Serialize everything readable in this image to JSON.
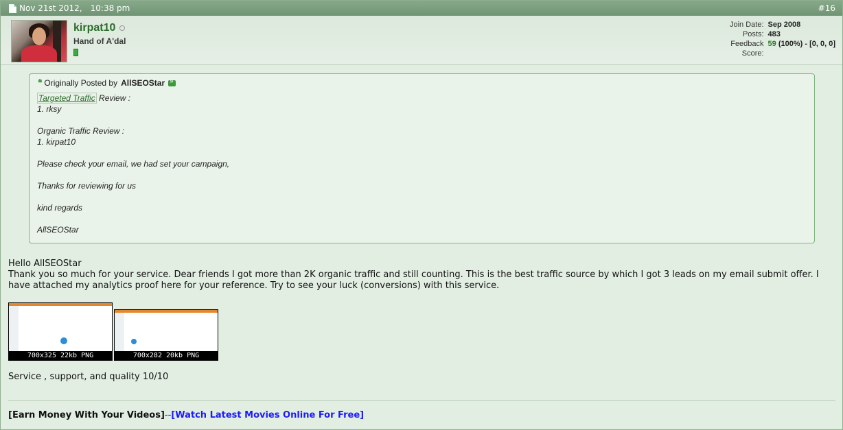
{
  "post": {
    "date": "Nov 21st 2012,",
    "time": "10:38 pm",
    "number": "#16"
  },
  "user": {
    "name": "kirpat10",
    "title": "Hand of A'dal",
    "join_date_label": "Join Date:",
    "join_date": "Sep 2008",
    "posts_label": "Posts:",
    "posts": "483",
    "feedback_label": "Feedback Score:",
    "feedback_score": "59",
    "feedback_pct": "(100%)",
    "feedback_detail": "- [0, 0, 0]"
  },
  "quote": {
    "prefix": "Originally Posted by",
    "author": "AllSEOStar",
    "link_text": "Targeted Traffic",
    "line1_rest": " Review :",
    "line2": "1. rksy",
    "line3": "Organic Traffic Review :",
    "line4": "1. kirpat10",
    "line5": "Please check your email, we had set your campaign,",
    "line6": "Thanks for reviewing for us",
    "line7": "kind regards",
    "line8": "AllSEOStar"
  },
  "message": {
    "greeting": "Hello AllSEOStar",
    "body": "Thank you so much for your service. Dear friends I got more than 2K organic traffic and still counting. This is the best traffic source by which I got 3 leads on my email submit offer. I have attached my analytics proof here for your reference. Try to see your luck (conversions) with this service.",
    "rating": "Service , support, and quality 10/10"
  },
  "attachments": [
    {
      "caption": "700x325 22kb PNG"
    },
    {
      "caption": "700x282 20kb PNG"
    }
  ],
  "signature": {
    "left": "[Earn Money With Your Videos]",
    "separator": "--",
    "right": "[Watch Latest Movies Online For Free]"
  },
  "colors": {
    "header": "#7a9f7e",
    "username": "#2d6b2d",
    "sig_link": "#1a1aff"
  }
}
